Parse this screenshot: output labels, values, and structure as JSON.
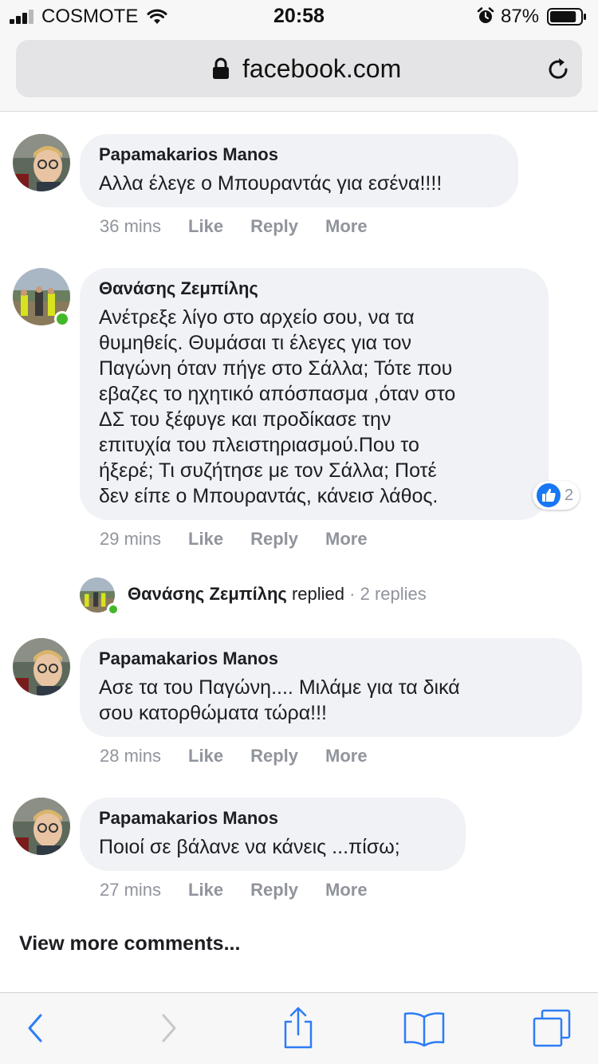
{
  "status_bar": {
    "carrier": "COSMOTE",
    "time": "20:58",
    "battery_percent": "87%",
    "signal_bars": 3,
    "battery_level": 0.87,
    "icons": [
      "signal-icon",
      "wifi-icon",
      "alarm-icon",
      "battery-icon"
    ]
  },
  "browser": {
    "url": "facebook.com",
    "icons": [
      "lock-icon",
      "reload-icon",
      "back-icon",
      "forward-icon",
      "share-icon",
      "bookmarks-icon",
      "tabs-icon"
    ]
  },
  "comments": [
    {
      "author": "Papamakarios Manos",
      "text": "Αλλα έλεγε ο Μπουραντάς για εσένα!!!!",
      "time": "36 mins",
      "like_label": "Like",
      "reply_label": "Reply",
      "more_label": "More",
      "online": false
    },
    {
      "author": "Θανάσης Ζεμπίλης",
      "text": "Ανέτρεξε λίγο στο αρχείο σου, να τα\nθυμηθείς. Θυμάσαι τι έλεγες για τον\nΠαγώνη όταν πήγε στο Σάλλα; Τότε που\nεβαζες το ηχητικό απόσπασμα ,όταν στο\nΔΣ του ξέφυγε και προδίκασε την\nεπιτυχία του πλειστηριασμού.Που το\nήξερέ; Τι συζήτησε με τον Σάλλα; Ποτέ\nδεν είπε ο Μπουραντάς, κάνεισ λάθος.",
      "time": "29 mins",
      "like_label": "Like",
      "reply_label": "Reply",
      "more_label": "More",
      "online": true,
      "reaction_count": "2",
      "reaction_color": "#1877f2"
    },
    {
      "author": "Papamakarios Manos",
      "text": "Ασε τα του Παγώνη.... Μιλάμε για τα δικά\nσου κατορθώματα τώρα!!!",
      "time": "28 mins",
      "like_label": "Like",
      "reply_label": "Reply",
      "more_label": "More",
      "online": false
    },
    {
      "author": "Papamakarios Manos",
      "text": "Ποιοί σε βάλανε να κάνεις ...πίσω;",
      "time": "27 mins",
      "like_label": "Like",
      "reply_label": "Reply",
      "more_label": "More",
      "online": false
    }
  ],
  "reply_summary": {
    "name": "Θανάσης Ζεμπίλης",
    "verb": "replied",
    "count": "· 2 replies"
  },
  "view_more": "View more comments...",
  "colors": {
    "bubble": "#f0f2f5",
    "meta_text": "#90949c",
    "online": "#42b72a",
    "ios_blue": "#2d7cf6"
  }
}
